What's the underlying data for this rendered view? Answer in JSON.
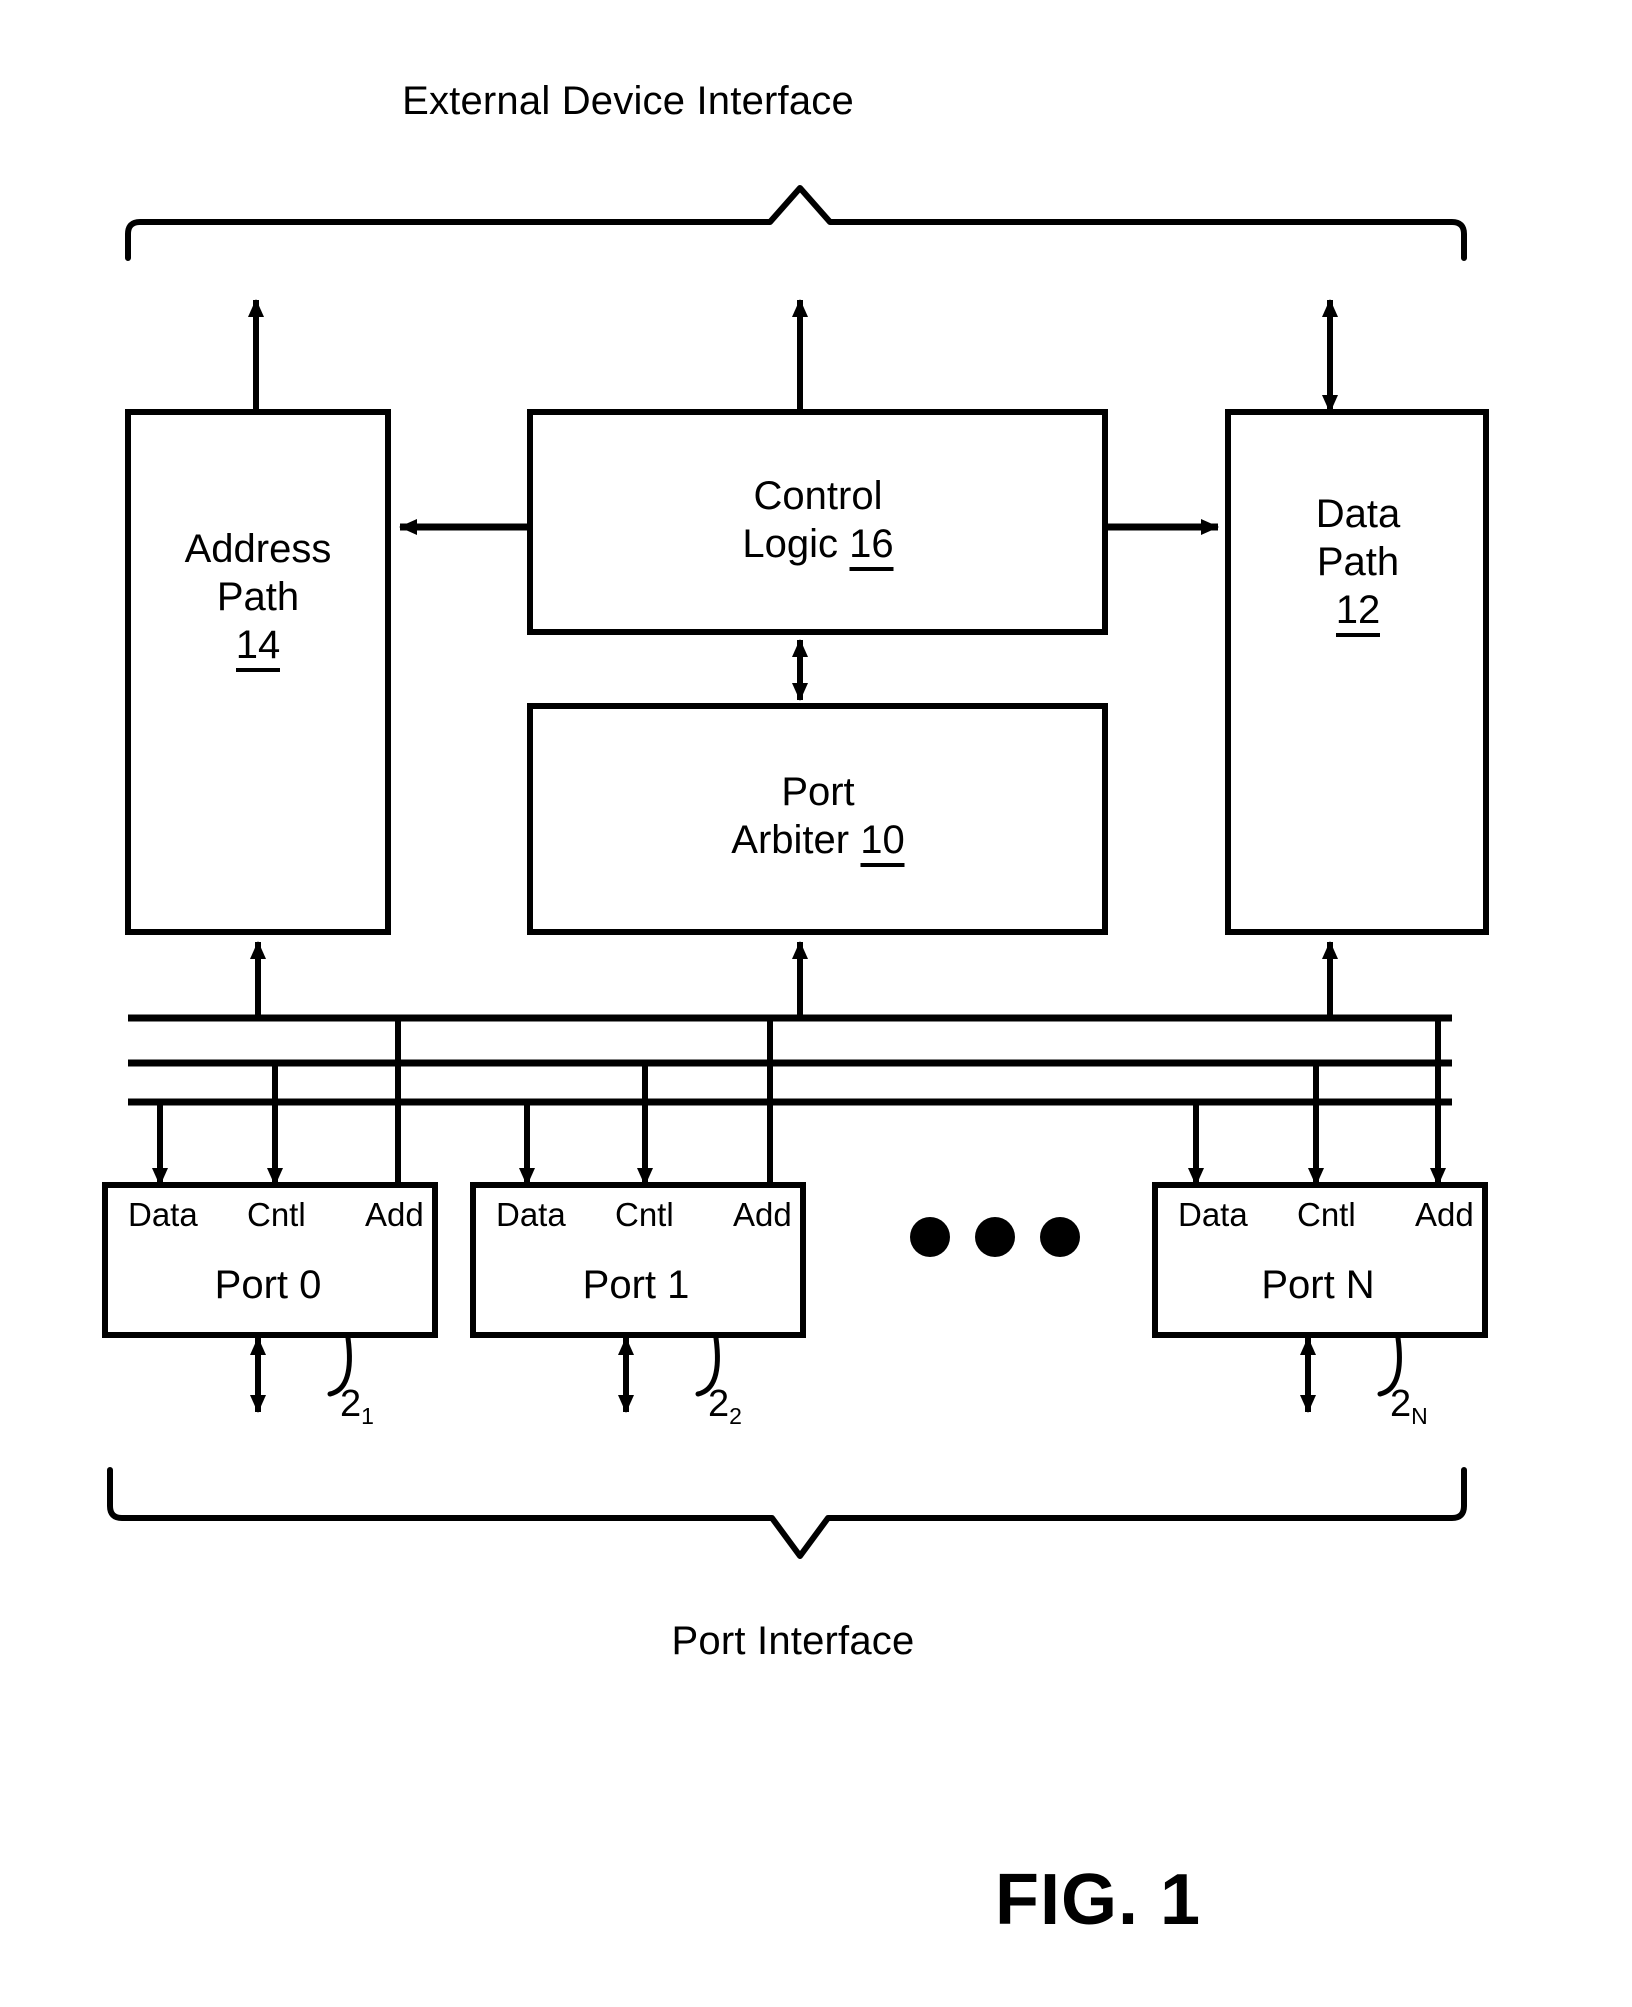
{
  "figure": {
    "top_title": "External Device Interface",
    "bottom_title": "Port Interface",
    "figure_label": "FIG. 1",
    "ink_color": "#000000",
    "background_color": "#ffffff"
  },
  "blocks": [
    {
      "id": "address-path",
      "line1": "Address",
      "line2": "Path",
      "ref": "14"
    },
    {
      "id": "control-logic",
      "line1": "Control",
      "line2": "Logic",
      "ref": "16"
    },
    {
      "id": "data-path",
      "line1": "Data",
      "line2": "Path",
      "ref": "12"
    },
    {
      "id": "port-arbiter",
      "line1": "Port",
      "line2": "Arbiter",
      "ref": "10"
    }
  ],
  "port_signal_labels": [
    "Data",
    "Cntl",
    "Add"
  ],
  "ports": [
    {
      "id": "port-0",
      "name": "Port 0",
      "ref_base": "2",
      "ref_sub": "1"
    },
    {
      "id": "port-1",
      "name": "Port 1",
      "ref_base": "2",
      "ref_sub": "2"
    },
    {
      "id": "port-n",
      "name": "Port N",
      "ref_base": "2",
      "ref_sub": "N"
    }
  ],
  "ellipsis": "• • •"
}
